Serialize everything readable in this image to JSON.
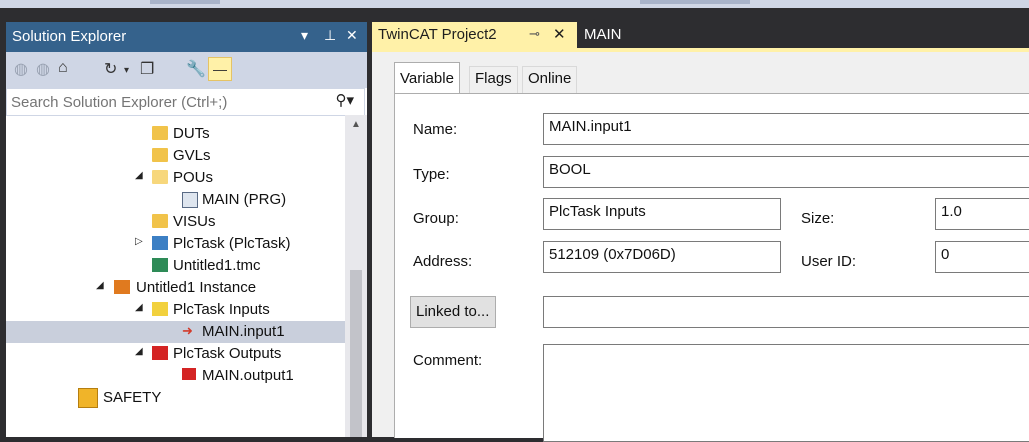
{
  "solution_explorer": {
    "title": "Solution Explorer",
    "pin_glyph": "▾ ⊥ ✕",
    "search_placeholder": "Search Solution Explorer (Ctrl+;)",
    "toolbar_icons": [
      "back-icon",
      "forward-icon",
      "home-icon",
      "history-icon",
      "collapse-icon",
      "properties-icon",
      "preview-icon"
    ],
    "tree": [
      {
        "label": "DUTs",
        "icon": "folder-icon",
        "expander": ""
      },
      {
        "label": "GVLs",
        "icon": "folder-icon",
        "expander": ""
      },
      {
        "label": "POUs",
        "icon": "folder-open-icon",
        "expander": "◢"
      },
      {
        "label": "MAIN (PRG)",
        "icon": "program-icon",
        "expander": ""
      },
      {
        "label": "VISUs",
        "icon": "folder-icon",
        "expander": ""
      },
      {
        "label": "PlcTask (PlcTask)",
        "icon": "task-icon",
        "expander": "▷"
      },
      {
        "label": "Untitled1.tmc",
        "icon": "tmc-icon",
        "expander": ""
      },
      {
        "label": "Untitled1 Instance",
        "icon": "instance-icon",
        "expander": "◢"
      },
      {
        "label": "PlcTask Inputs",
        "icon": "inputs-icon",
        "expander": "◢"
      },
      {
        "label": "MAIN.input1",
        "icon": "input-var-icon",
        "expander": ""
      },
      {
        "label": "PlcTask Outputs",
        "icon": "outputs-icon",
        "expander": "◢"
      },
      {
        "label": "MAIN.output1",
        "icon": "output-var-icon",
        "expander": ""
      },
      {
        "label": "SAFETY",
        "icon": "safety-icon",
        "expander": ""
      }
    ]
  },
  "editor": {
    "tabs": [
      {
        "label": "TwinCAT Project2",
        "active": true
      },
      {
        "label": "MAIN",
        "active": false
      }
    ],
    "inner_tabs": [
      "Variable",
      "Flags",
      "Online"
    ],
    "fields": {
      "name_label": "Name:",
      "name_value": "MAIN.input1",
      "type_label": "Type:",
      "type_value": "BOOL",
      "group_label": "Group:",
      "group_value": "PlcTask Inputs",
      "size_label": "Size:",
      "size_value": "1.0",
      "address_label": "Address:",
      "address_value": "512109 (0x7D06D)",
      "userid_label": "User ID:",
      "userid_value": "0",
      "linked_button": "Linked to...",
      "linked_value": "",
      "comment_label": "Comment:",
      "comment_value": ""
    }
  },
  "colors": {
    "title_bar": "#35628c",
    "active_tab": "#fff1a8",
    "selection": "#c9cfdc",
    "frame": "#2d2d30"
  }
}
